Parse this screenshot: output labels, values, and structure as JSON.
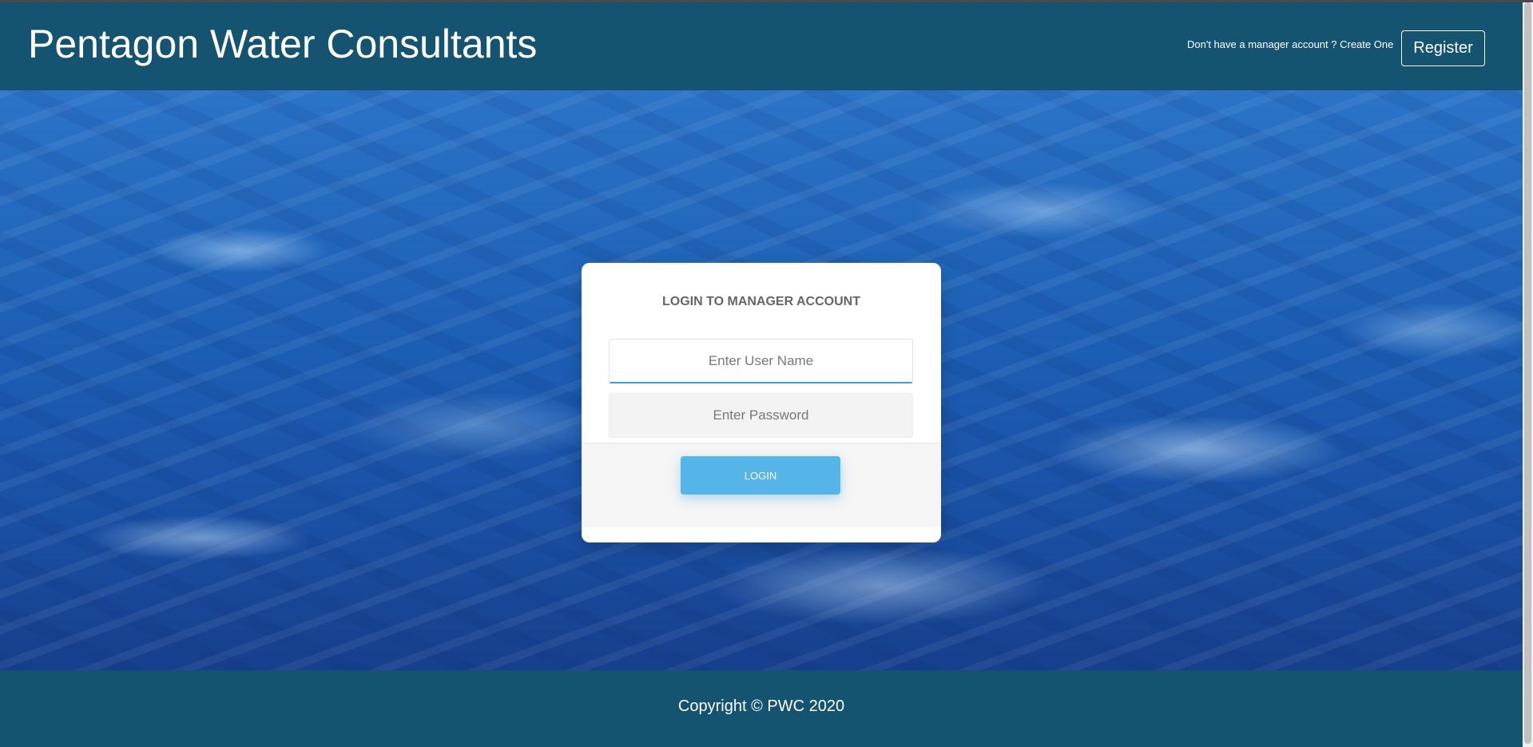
{
  "header": {
    "brand": "Pentagon Water Consultants",
    "register_hint": "Don't have a manager account ? Create One",
    "register_label": "Register"
  },
  "login": {
    "title": "LOGIN TO MANAGER ACCOUNT",
    "username_placeholder": "Enter User Name",
    "username_value": "",
    "password_placeholder": "Enter Password",
    "password_value": "",
    "submit_label": "LOGIN"
  },
  "footer": {
    "copyright": "Copyright © PWC 2020"
  },
  "colors": {
    "header_bg": "#155470",
    "button_accent": "#55b4e8",
    "focus_underline": "#39a4d6"
  }
}
